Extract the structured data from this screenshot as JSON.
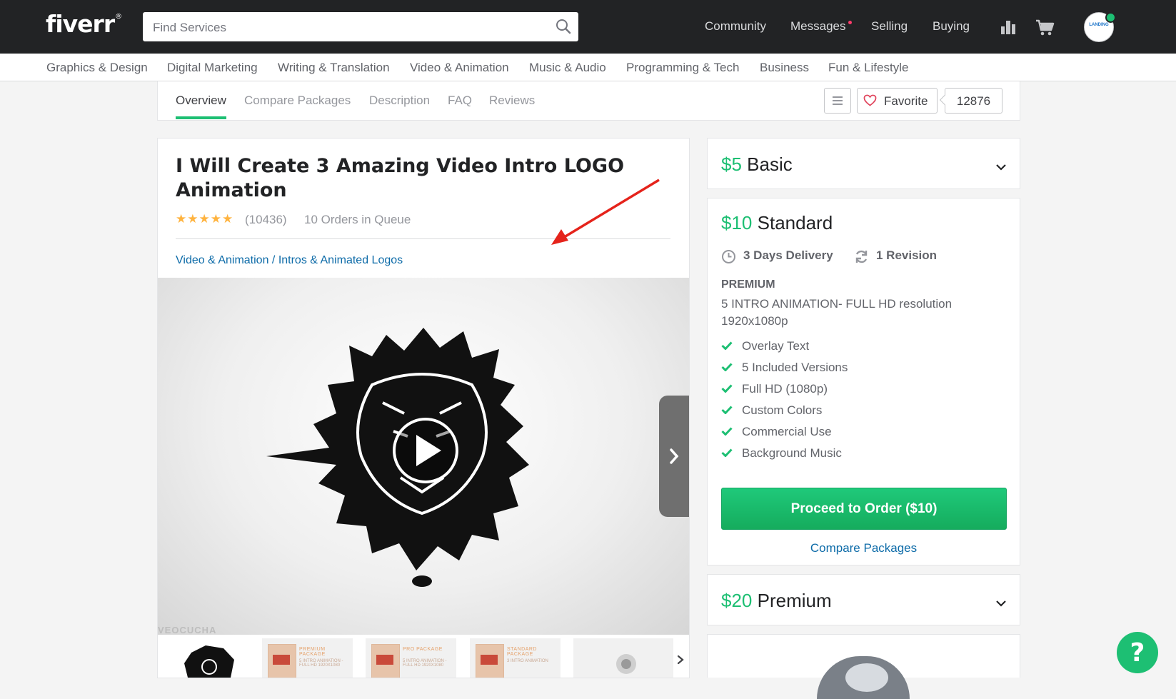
{
  "header": {
    "logo": "fiverr",
    "logo_mark": "®",
    "search_placeholder": "Find Services",
    "nav": [
      "Community",
      "Messages",
      "Selling",
      "Buying"
    ],
    "icons": [
      "search-icon",
      "stats-icon",
      "cart-icon"
    ],
    "avatar_text": "LANDING"
  },
  "categories": [
    "Graphics & Design",
    "Digital Marketing",
    "Writing & Translation",
    "Video & Animation",
    "Music & Audio",
    "Programming & Tech",
    "Business",
    "Fun & Lifestyle"
  ],
  "section_tabs": {
    "items": [
      "Overview",
      "Compare Packages",
      "Description",
      "FAQ",
      "Reviews"
    ],
    "active": "Overview",
    "favorite_label": "Favorite",
    "favorite_count": "12876"
  },
  "gig": {
    "title": "I Will Create 3 Amazing Video Intro LOGO Animation",
    "rating": 5,
    "rating_count": "(10436)",
    "queue": "10 Orders in Queue",
    "breadcrumb": [
      "Video & Animation",
      "Intros & Animated Logos"
    ],
    "breadcrumb_sep": " / ",
    "video_watermark": "VEOCUCHA",
    "thumbnails": [
      {
        "kind": "tiger"
      },
      {
        "kind": "package",
        "label": "PREMIUM PACKAGE",
        "line": "5 INTRO ANIMATION -FULL HD 1920X1080"
      },
      {
        "kind": "package",
        "label": "PRO PACKAGE",
        "line": "5 INTRO ANIMATION -FULL HD 1920X1080"
      },
      {
        "kind": "package",
        "label": "STANDARD PACKAGE",
        "line": "3 INTRO ANIMATION"
      },
      {
        "kind": "logo"
      }
    ]
  },
  "packages": {
    "basic": {
      "price": "$5",
      "name": "Basic"
    },
    "standard": {
      "price": "$10",
      "name": "Standard",
      "delivery": "3 Days Delivery",
      "revisions": "1 Revision",
      "tier_label": "PREMIUM",
      "description": "5 INTRO ANIMATION- FULL HD resolution 1920x1080p",
      "features": [
        "Overlay Text",
        "5 Included Versions",
        "Full HD (1080p)",
        "Custom Colors",
        "Commercial Use",
        "Background Music"
      ],
      "order_button": "Proceed to Order ($10)",
      "compare_link": "Compare Packages"
    },
    "premium": {
      "price": "$20",
      "name": "Premium"
    }
  },
  "help_button": "?",
  "colors": {
    "accent": "#1dbf73",
    "link": "#0d6ba8",
    "header_bg": "#222325",
    "annotation_arrow": "#e5231b",
    "star": "#ffb33e"
  }
}
